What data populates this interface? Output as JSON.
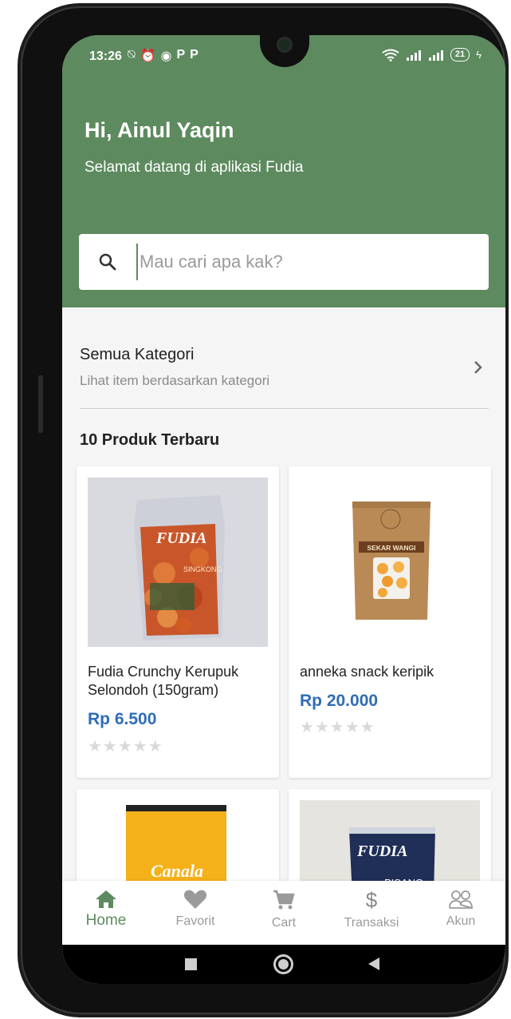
{
  "status_bar": {
    "time": "13:26",
    "left_icons": [
      "notification-off-icon",
      "alarm-icon",
      "app-icon",
      "p-icon",
      "p-icon"
    ],
    "battery_level": "21"
  },
  "header": {
    "greeting": "Hi, Ainul Yaqin",
    "subtitle": "Selamat datang di aplikasi Fudia",
    "background_color": "#5d8a5e"
  },
  "search": {
    "placeholder": "Mau cari apa kak?"
  },
  "category": {
    "title": "Semua Kategori",
    "subtitle": "Lihat item berdasarkan kategori"
  },
  "products_section": {
    "title": "10 Produk Terbaru",
    "items": [
      {
        "name": "Fudia Crunchy Kerupuk Selondoh (150gram)",
        "price": "Rp 6.500",
        "rating": 0,
        "image_text": "FUDIA",
        "image_subtext": "SINGKONG"
      },
      {
        "name": "anneka snack keripik",
        "price": "Rp 20.000",
        "rating": 0,
        "image_text": "SEKAR WANGI"
      },
      {
        "image_text": "Canala"
      },
      {
        "image_text": "FUDIA",
        "image_subtext": "PISANG"
      }
    ]
  },
  "bottom_nav": {
    "items": [
      {
        "label": "Home",
        "icon": "home-icon",
        "active": true
      },
      {
        "label": "Favorit",
        "icon": "heart-icon",
        "active": false
      },
      {
        "label": "Cart",
        "icon": "cart-icon",
        "active": false
      },
      {
        "label": "Transaksi",
        "icon": "dollar-icon",
        "active": false
      },
      {
        "label": "Akun",
        "icon": "users-icon",
        "active": false
      }
    ]
  },
  "colors": {
    "accent": "#5d8a5e",
    "price": "#2f6db5"
  }
}
